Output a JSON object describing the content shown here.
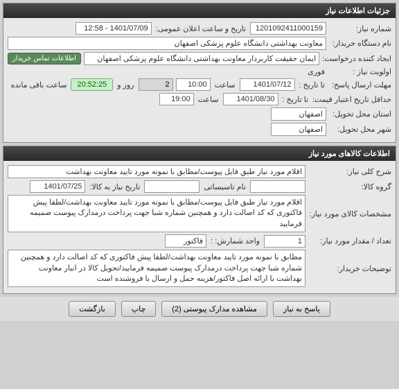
{
  "panel1": {
    "title": "جزئیات اطلاعات نیاز",
    "need_number_label": "شماره نیاز:",
    "need_number": "1201092411000159",
    "public_date_label": "تاریخ و ساعت اعلان عمومی:",
    "public_date": "1401/07/09 - 12:58",
    "buyer_name_label": "نام دستگاه خریدار:",
    "buyer_name": "معاونت بهداشتی دانشگاه علوم پزشکی اصفهان",
    "creator_label": "ایجاد کننده درخواست:",
    "creator": "ایمان حقیقت کاربردار معاونت بهداشتی دانشگاه علوم پزشکی اصفهان",
    "creator_btn": "اطلاعات تماس خریدار",
    "priority_label": "اولویت نیاز :",
    "priority": "فوری",
    "response_deadline_label": "مهلت ارسال پاسخ:",
    "to_date_label": "تا تاریخ :",
    "response_date": "1401/07/12",
    "time_label": "ساعت",
    "response_time": "10:00",
    "days_remain": "2",
    "days_remain_label": "روز و",
    "countdown": "20:52:25",
    "countdown_label": "ساعت باقی مانده",
    "validity_label": "حداقل تاریخ اعتبار قیمت:",
    "validity_date": "1401/08/30",
    "validity_time": "19:00",
    "delivery_province_label": "استان محل تحویل:",
    "delivery_province": "اصفهان",
    "delivery_city_label": "شهر محل تحویل:",
    "delivery_city": "اصفهان"
  },
  "panel2": {
    "title": "اطلاعات کالاهای مورد نیاز",
    "general_desc_label": "شرح کلی نیاز:",
    "general_desc": "اقلام مورد نیاز طبق فایل پیوست/مطابق با نمونه مورد تایید معاونت بهداشت",
    "goods_group_label": "گروه کالا:",
    "goods_group": "",
    "install_name_label": "نام تاسیساتی",
    "install_name": "",
    "need_date_label": "تاریخ نیاز به کالا:",
    "need_date": "1401/07/25",
    "goods_spec_label": "مشخصات کالای مورد نیاز:",
    "goods_spec": "اقلام مورد نیاز طبق فایل پیوست/مطابق با نمونه مورد تایید معاونت بهداشت/لطفا پیش فاکتوری که کد اصالت دارد و همچنین شماره شبا جهت پرداخت درمدارک پیوست ضمیمه فرمایید",
    "qty_label": "تعداد / مقدار مورد نیاز:",
    "qty": "1",
    "unit_label": "واحد شمارش:  :",
    "unit": "فاکتور",
    "buyer_notes_label": "توضیحات خریدار:",
    "buyer_notes": "مطابق با نمونه مورد تایید معاونت بهداشت/لطفا پیش فاکتوری که کد اصالت دارد و همچنین شماره شبا جهت پرداخت درمدارک پیوست ضمیمه فرمایید/تحویل کالا در انبار معاونت بهداشت با ارائه اصل فاکتور/هزینه حمل و ارسال با فروشنده است"
  },
  "actions": {
    "reply": "پاسخ به نیاز",
    "attachments": "مشاهده مدارک پیوستی (2)",
    "print": "چاپ",
    "back": "بازگشت"
  }
}
